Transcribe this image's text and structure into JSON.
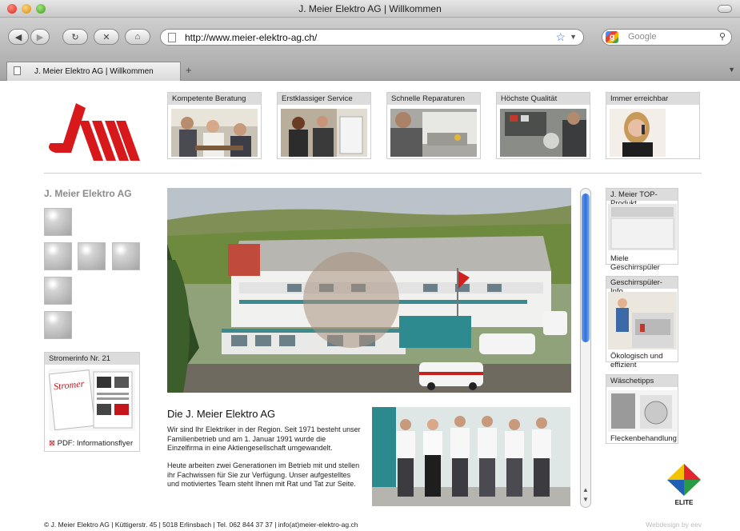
{
  "window": {
    "title": "J. Meier Elektro AG | Willkommen"
  },
  "toolbar": {
    "url": "http://www.meier-elektro-ag.ch/",
    "search_placeholder": "Google",
    "back_icon": "back-arrow-icon",
    "forward_icon": "forward-arrow-icon",
    "reload_icon": "reload-icon",
    "stop_icon": "stop-icon",
    "home_icon": "home-icon"
  },
  "tabs": [
    {
      "label": "J. Meier Elektro AG | Willkommen"
    }
  ],
  "topnav": [
    {
      "label": "Kompetente Beratung"
    },
    {
      "label": "Erstklassiger Service"
    },
    {
      "label": "Schnelle Reparaturen"
    },
    {
      "label": "Höchste Qualität"
    },
    {
      "label": "Immer erreichbar"
    }
  ],
  "sidebar": {
    "heading": "J. Meier Elektro AG",
    "info_box": {
      "title": "Stromerinfo Nr. 21",
      "link": "PDF: Informationsflyer"
    }
  },
  "content": {
    "heading": "Die J. Meier Elektro AG",
    "paragraph1": "Wir sind Ihr Elektriker in der Region. Seit 1971 besteht unser Familienbetrieb und am 1. Januar 1991 wurde die Einzelfirma in eine Aktiengesellschaft umgewandelt.",
    "paragraph2": "Heute arbeiten zwei Generationen im Betrieb mit und stellen ihr Fachwissen für Sie zur Verfügung. Unser aufgestelltes und motiviertes Team steht Ihnen mit Rat und Tat zur Seite."
  },
  "right_promos": [
    {
      "title": "J. Meier TOP-Produkt",
      "caption": "Miele Geschirrspüler"
    },
    {
      "title": "Geschirrspüler-Info",
      "caption": "Ökologisch und effizient"
    },
    {
      "title": "Wäschetipps",
      "caption": "Fleckenbehandlung"
    }
  ],
  "elite_label": "ELITE",
  "footer": {
    "text": "© J. Meier Elektro AG | Küttigerstr. 45 | 5018 Erlinsbach | Tel. 062 844 37 37 | info(at)meier-elektro-ag.ch",
    "credit": "Webdesign by eev"
  },
  "colors": {
    "logo_red": "#d7191c",
    "caption_bg": "#dcdcdc",
    "scroll_blue": "#2f6fd8"
  }
}
